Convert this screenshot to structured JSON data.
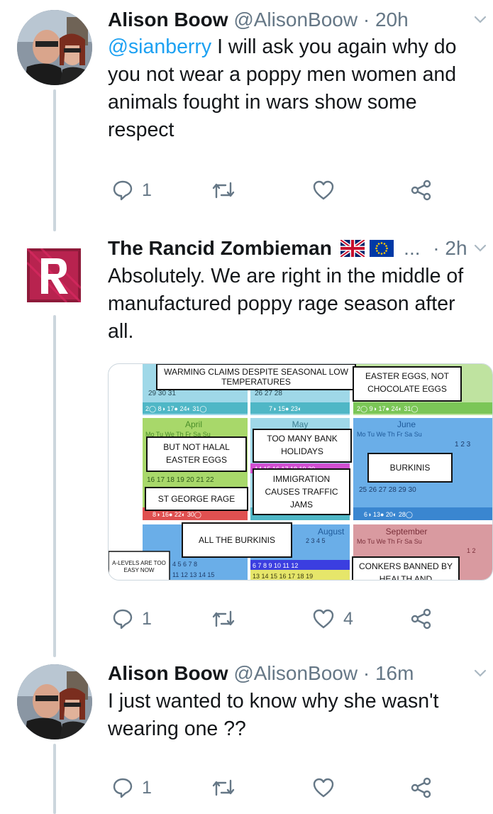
{
  "tweets": [
    {
      "name": "Alison Boow",
      "handle": "@AlisonBoow",
      "sep": "·",
      "time": "20h",
      "mention": "@sianberry",
      "text": " I will ask you again why do you not wear a poppy men women and animals fought in wars show some respect",
      "replies": "1",
      "retweets": "",
      "likes": ""
    },
    {
      "name": "The Rancid Zombieman",
      "flags": [
        "uk-flag",
        "eu-flag"
      ],
      "ellipsis": "...",
      "sep": "·",
      "time": "2h",
      "text": "Absolutely. We are right in the middle of manufactured poppy rage season after all.",
      "replies": "1",
      "retweets": "",
      "likes": "4",
      "media": {
        "months": [
          "April",
          "May",
          "June",
          "August",
          "September"
        ],
        "weekdays": "Mo Tu We Th Fr Sa Su",
        "labels": {
          "warming": "WARMING CLAIMS DESPITE SEASONAL LOW TEMPERATURES",
          "easter": "EASTER EGGS, NOT CHOCOLATE EGGS",
          "halal": "BUT NOT HALAL EASTER EGGS",
          "bank": "TOO MANY BANK HOLIDAYS",
          "burkinis": "BURKINIS",
          "stgeorge": "ST GEORGE RAGE",
          "immigration": "IMMIGRATION CAUSES TRAFFIC JAMS",
          "allburkinis": "ALL THE BURKINIS",
          "alevels": "A-LEVELS ARE TOO EASY NOW",
          "conkers": "CONKERS BANNED BY HEALTH AND"
        },
        "rows": {
          "r1a": "29  30  31",
          "r1b": "26  27  28",
          "moonA": "2◯  8◑  17●  24◐  31◯",
          "moonB": "7◑  15●  23◐",
          "moonC": "2◯  9◑  17●  24◐  31◯",
          "aprilRow": "16  17  18  19  20  21  22",
          "aprilMoon": "8◑  16●  22◐  30◯",
          "juneLast": "25  26  27  28  29  30",
          "juneMoon": "6◑  13●  20◐  28◯",
          "mayRow": "14  15  16  17  18  19  20",
          "juneTop": "1  2  3",
          "augRow1": "2  3  4  5",
          "augRow2": "6  7  8  9  10  11  12",
          "augRow3": "13  14  15  16  17  18  19",
          "sepRow1": "1  2",
          "leftRow2": "4  5  6  7  8",
          "leftRow3": "11  12  13  14  15"
        }
      }
    },
    {
      "name": "Alison Boow",
      "handle": "@AlisonBoow",
      "sep": "·",
      "time": "16m",
      "text": "I just wanted to know why she wasn't wearing one ??",
      "replies": "1",
      "retweets": "",
      "likes": ""
    }
  ],
  "colors": {
    "text": "#14171a",
    "secondary": "#657786",
    "link": "#1da1f2",
    "threadLine": "#ccd6dd"
  }
}
